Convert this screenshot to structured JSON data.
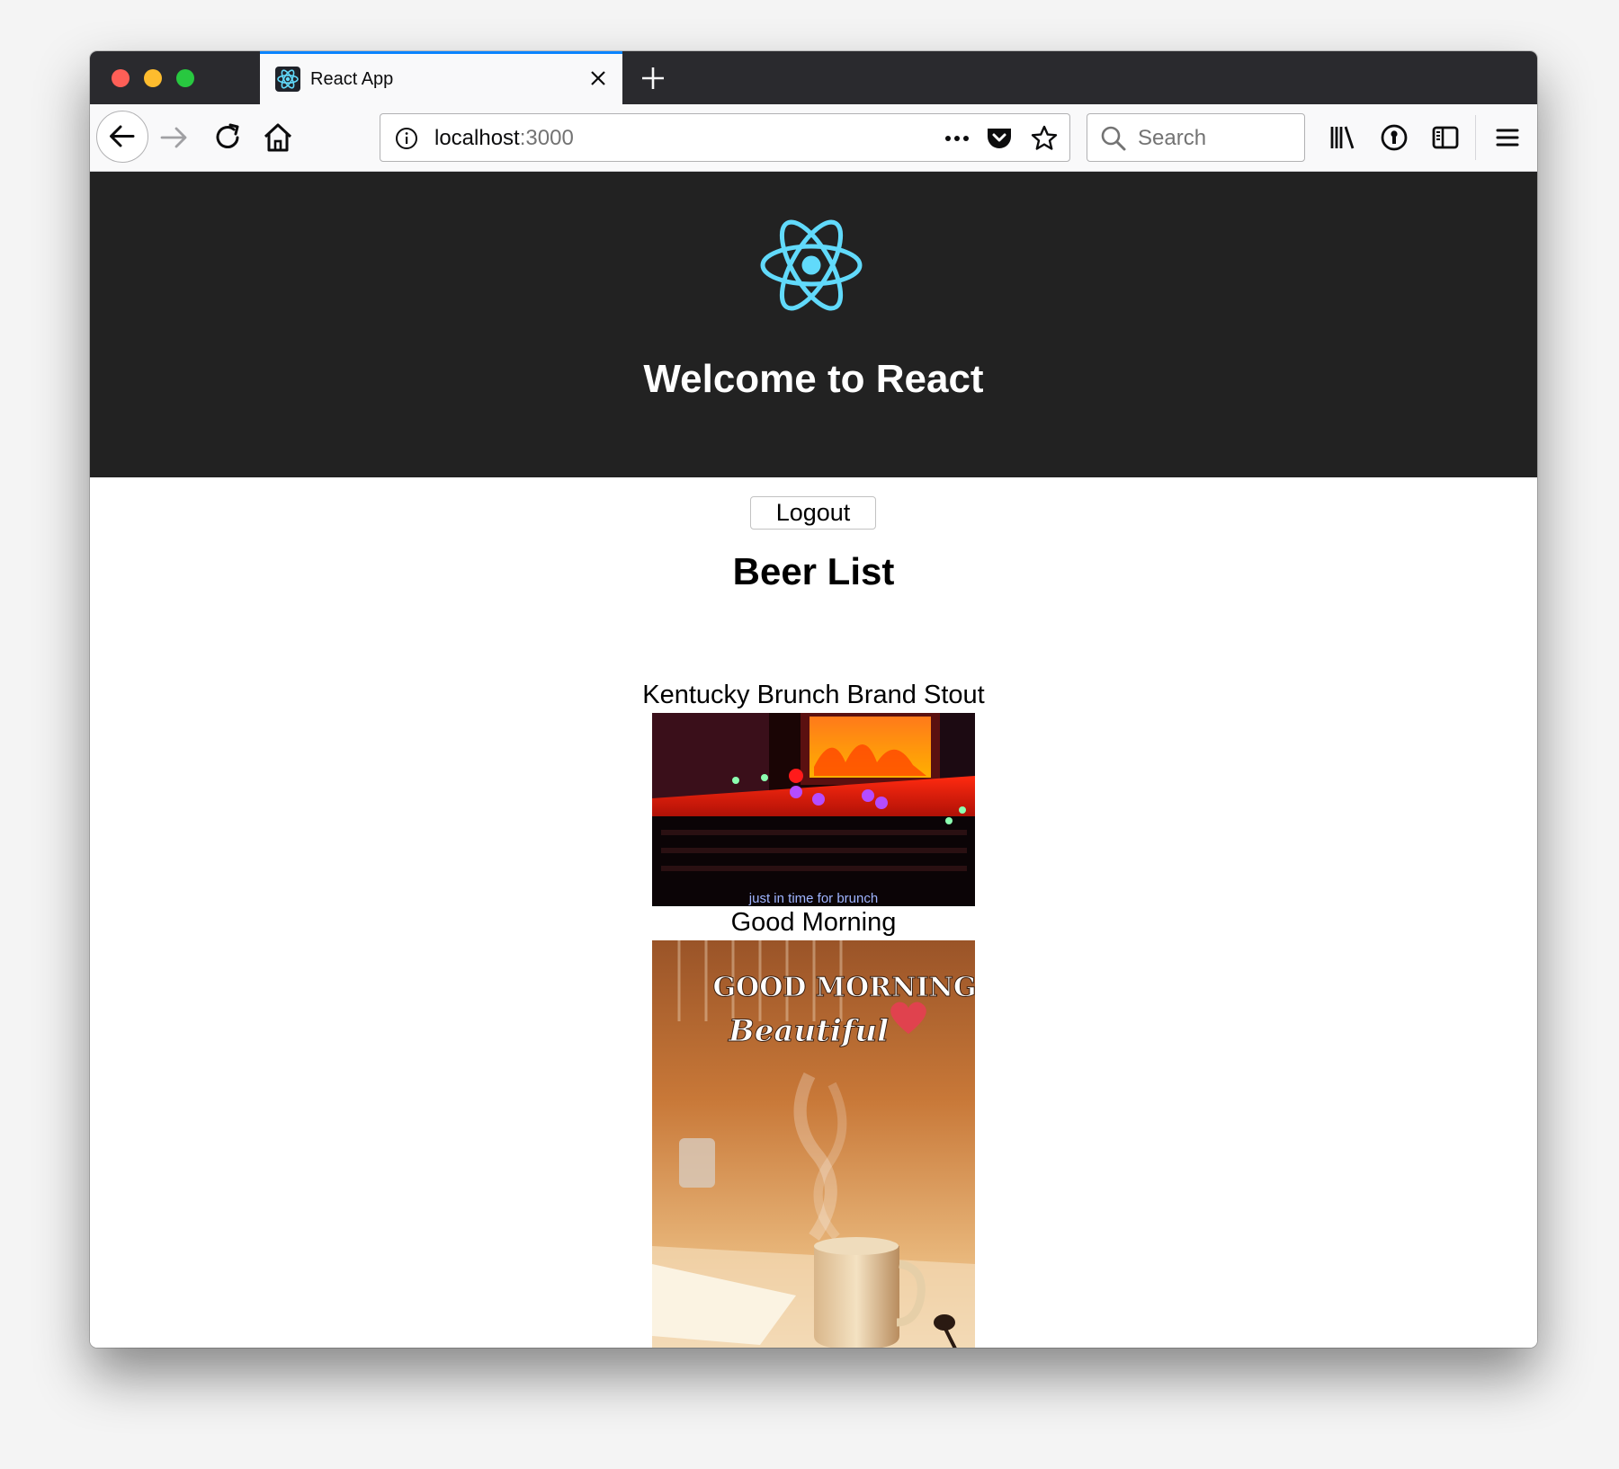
{
  "browser": {
    "tab": {
      "title": "React App",
      "favicon": "react-icon"
    },
    "url": {
      "host": "localhost",
      "port": ":3000"
    },
    "search": {
      "placeholder": "Search"
    }
  },
  "app": {
    "title": "Welcome to React",
    "logout_label": "Logout",
    "list_title": "Beer List",
    "beers": [
      {
        "name": "Kentucky Brunch Brand Stout",
        "caption": "just in time for brunch"
      },
      {
        "name": "Good Morning",
        "image_text_line1": "GOOD MORNING",
        "image_text_line2": "Beautiful"
      }
    ]
  },
  "colors": {
    "react_blue": "#61dafb",
    "header_bg": "#222222",
    "tab_accent": "#0a84ff"
  }
}
